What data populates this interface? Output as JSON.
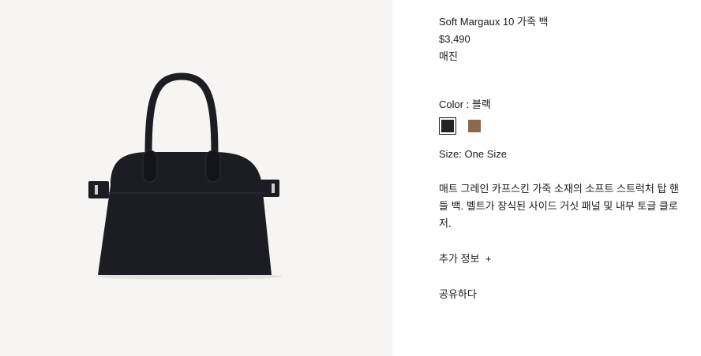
{
  "product": {
    "title": "Soft Margaux 10 가죽 백",
    "price": "$3,490",
    "stock_status": "매진",
    "color_label": "Color : ",
    "color_value": "블랙",
    "swatches": [
      {
        "name": "블랙",
        "hex": "#23242a",
        "selected": true
      },
      {
        "name": "브라운",
        "hex": "#8a6a4f",
        "selected": false
      }
    ],
    "size_label": "Size: ",
    "size_value": "One Size",
    "description": "매트 그레인 카프스킨 가죽 소재의 소프트 스트럭처 탑 핸들 백. 벨트가 장식된 사이드 거싯 패널 및 내부 토글 클로저.",
    "more_info_label": "추가 정보",
    "more_info_icon": "+",
    "share_label": "공유하다"
  },
  "image": {
    "subject": "black-leather-handbag",
    "background_color": "#f6f5f3",
    "bag_color": "#1c1d22"
  }
}
